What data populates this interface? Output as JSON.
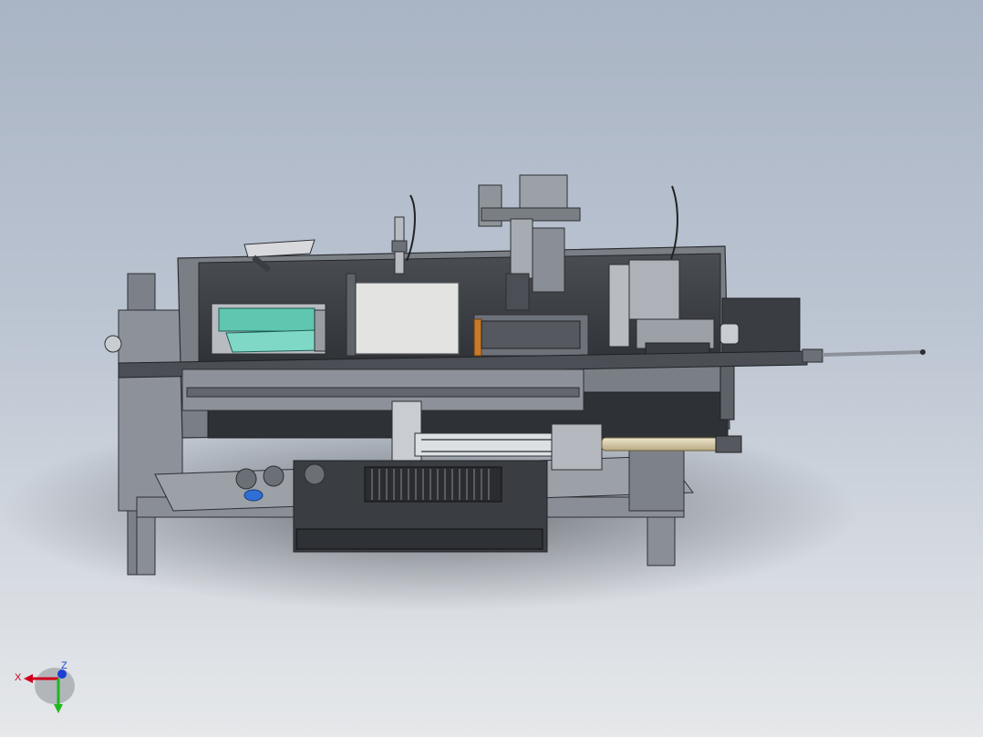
{
  "triad": {
    "x_label": "X",
    "z_label": "Z",
    "x_color": "#d0021b",
    "y_color": "#1fb81f",
    "z_color": "#1c3fd6"
  },
  "colors": {
    "background_top": "#a9b4c4",
    "background_bottom": "#e6e8ea",
    "frame": "#6b6f76",
    "panel_dark": "#3a3d42",
    "guard_cover": "#e3e4e2",
    "teal_part": "#5fc6b0",
    "orange_part": "#c87b2a",
    "rod": "#d8cdb2"
  }
}
